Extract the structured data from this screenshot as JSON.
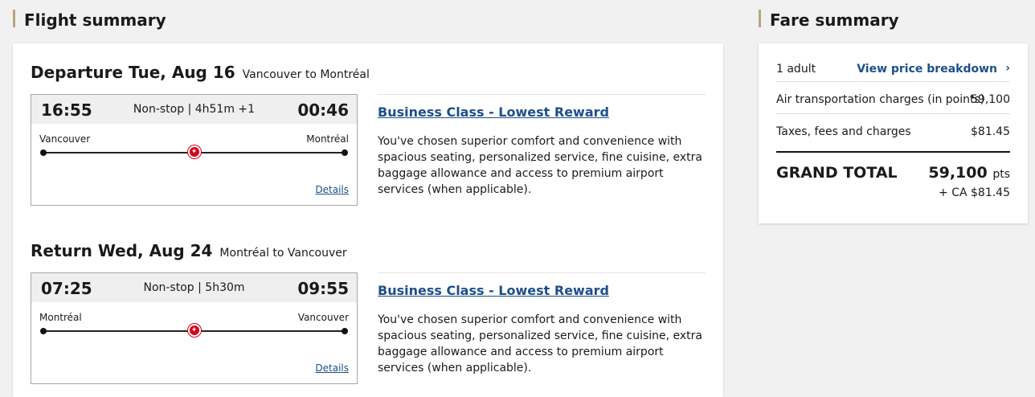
{
  "flight_summary": {
    "heading": "Flight summary",
    "bounds": [
      {
        "label": "Departure Tue, Aug 16",
        "route": "Vancouver to Montréal",
        "dep_time": "16:55",
        "arr_time": "00:46",
        "stops": "Non-stop | 4h51m +1",
        "origin": "Vancouver",
        "destination": "Montréal",
        "details_label": "Details",
        "fare_name": "Business Class - Lowest Reward",
        "fare_description": "You've chosen superior comfort and convenience with spacious seating, personalized service, fine cuisine, extra baggage allowance and access to premium airport services (when applicable)."
      },
      {
        "label": "Return Wed, Aug 24",
        "route": "Montréal to Vancouver",
        "dep_time": "07:25",
        "arr_time": "09:55",
        "stops": "Non-stop | 5h30m",
        "origin": "Montréal",
        "destination": "Vancouver",
        "details_label": "Details",
        "fare_name": "Business Class - Lowest Reward",
        "fare_description": "You've chosen superior comfort and convenience with spacious seating, personalized service, fine cuisine, extra baggage allowance and access to premium airport services (when applicable)."
      }
    ]
  },
  "fare_summary": {
    "heading": "Fare summary",
    "passengers": "1 adult",
    "breakdown_link": "View price breakdown",
    "air_label": "Air transportation charges (in points)",
    "air_value": "59,100",
    "tax_label": "Taxes, fees and charges",
    "tax_value": "$81.45",
    "grand_label": "GRAND TOTAL",
    "grand_points": "59,100",
    "grand_points_unit": "pts",
    "grand_cash": "+ CA $81.45"
  },
  "icons": {
    "airline": "maple-leaf-icon",
    "chevron": "chevron-right-icon"
  },
  "colors": {
    "accent": "#b9a383",
    "link": "#1d4f8a",
    "brand_red": "#d8001a"
  }
}
